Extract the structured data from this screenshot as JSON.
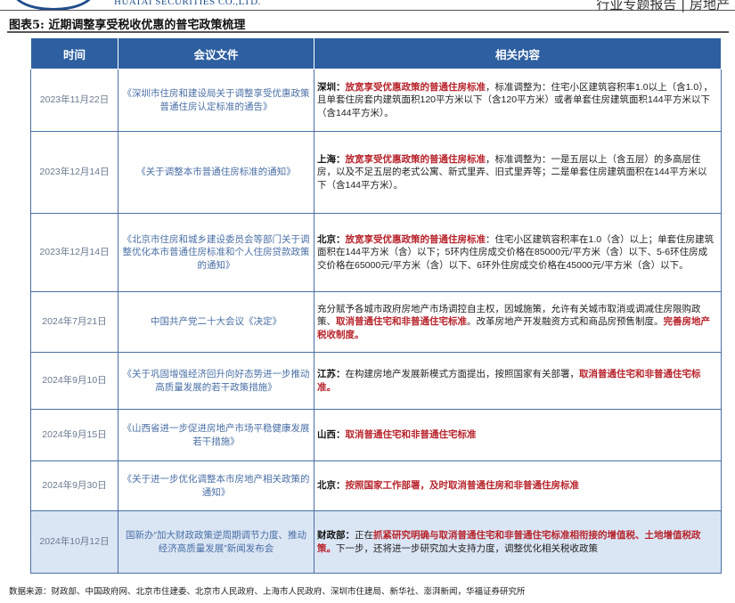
{
  "header": {
    "logo_text": "HUATAI SECURITIES CO.,LTD.",
    "report_type": "行业专题报告 | 房地产"
  },
  "figure": {
    "title": "图表5: 近期调整享受税收优惠的普宅政策梳理",
    "source": "数据来源：财政部、中国政府网、北京市住建委、北京市人民政府、上海市人民政府、深圳市住建局、新华社、澎湃新闻，华福证券研究所"
  },
  "table": {
    "headers": [
      "时间",
      "会议文件",
      "相关内容"
    ],
    "rows": [
      {
        "date": "2023年11月22日",
        "doc": "《深圳市住房和建设局关于调整享受优惠政策普通住房认定标准的通告》",
        "lead": "深圳：",
        "emph": "放宽享受优惠政策的普通住房标准",
        "rest": "，标准调整为：住宅小区建筑容积率1.0以上（含1.0），且单套住房套内建筑面积120平方米以下（含120平方米）或者单套住房建筑面积144平方米以下（含144平方米）。"
      },
      {
        "date": "2023年12月14日",
        "doc": "《关于调整本市普通住房标准的通知》",
        "lead": "上海：",
        "emph": "放宽享受优惠政策的普通住房标准",
        "rest": "，标准调整为：一是五层以上（含五层）的多高层住房，以及不足五层的老式公寓、新式里弄、旧式里弄等；二是单套住房建筑面积在144平方米以下（含144平方米）。"
      },
      {
        "date": "2023年12月14日",
        "doc": "《北京市住房和城乡建设委员会等部门关于调整优化本市普通住房标准和个人住房贷款政策的通知》",
        "lead": "北京：",
        "emph": "放宽享受优惠政策的普通住房标准",
        "rest": "：住宅小区建筑容积率在1.0（含）以上；单套住房建筑面积在144平方米（含）以下；5环内住房成交价格在85000元/平方米（含）以下、5-6环住房成交价格在65000元/平方米（含）以下、6环外住房成交价格在45000元/平方米（含）以下。"
      },
      {
        "date": "2024年7月21日",
        "doc": "中国共产党二十大会议《决定》",
        "pre": "充分赋予各城市政府房地产市场调控自主权，因城施策，允许有关城市取消或调减住房限购政策、",
        "emph": "取消普通住宅和非普通住宅标准",
        "mid": "。改革房地产开发融资方式和商品房预售制度。",
        "emph2": "完善房地产税收制度。"
      },
      {
        "date": "2024年9月10日",
        "doc": "《关于巩固增强经济回升向好态势进一步推动高质量发展的若干政策措施》",
        "lead": "江苏：",
        "pre": "在构建房地产发展新模式方面提出，按照国家有关部署，",
        "emph": "取消普通住宅和非普通住宅标准。"
      },
      {
        "date": "2024年9月15日",
        "doc": "《山西省进一步促进房地产市场平稳健康发展若干措施》",
        "lead": "山西：",
        "emph": "取消普通住宅和非普通住宅标准"
      },
      {
        "date": "2024年9月30日",
        "doc": "《关于进一步优化调整本市房地产相关政策的通知》",
        "lead": "北京：",
        "emph": "按照国家工作部署，及时取消普通住房和非普通住房标准"
      },
      {
        "date": "2024年10月12日",
        "doc": "国新办“加大财政政策逆周期调节力度、推动经济高质量发展”新闻发布会",
        "lead": "财政部：",
        "pre": "正在",
        "emph": "抓紧研究明确与取消普通住宅和非普通住宅标准相衔接的增值税、土地增值税政策。",
        "rest": "下一步，还将进一步研究加大支持力度，调整优化相关税收政策"
      }
    ]
  }
}
